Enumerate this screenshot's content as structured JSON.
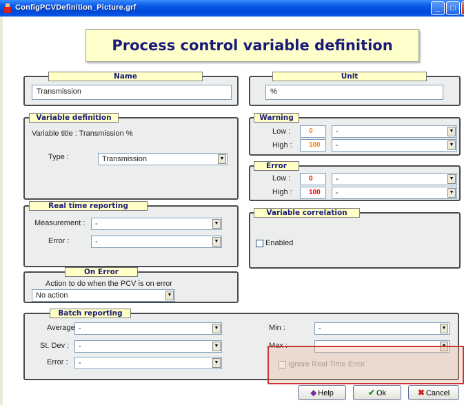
{
  "window": {
    "title": "ConfigPCVDefinition_Picture.grf"
  },
  "header": {
    "title": "Process control variable definition"
  },
  "name_group": {
    "label": "Name",
    "value": "Transmission"
  },
  "unit_group": {
    "label": "Unit",
    "value": "%"
  },
  "variable_definition": {
    "label": "Variable definition",
    "title_text": "Variable title : Transmission  %",
    "type_label": "Type :",
    "type_value": "Transmission"
  },
  "warning": {
    "label": "Warning",
    "low_label": "Low :",
    "low_value": "0",
    "low_select": "-",
    "high_label": "High :",
    "high_value": "100",
    "high_select": "-"
  },
  "error": {
    "label": "Error",
    "low_label": "Low :",
    "low_value": "0",
    "low_select": "-",
    "high_label": "High :",
    "high_value": "100",
    "high_select": "-"
  },
  "real_time": {
    "label": "Real time reporting",
    "measurement_label": "Measurement :",
    "measurement_value": "-",
    "error_label": "Error :",
    "error_value": "-"
  },
  "variable_correlation": {
    "label": "Variable correlation",
    "enabled_label": "Enabled"
  },
  "on_error": {
    "label": "On Error",
    "description": "Action to do when the PCV is on error",
    "action_value": "No action"
  },
  "batch": {
    "label": "Batch reporting",
    "average_label": "Average :",
    "average_value": "-",
    "stdev_label": "St. Dev :",
    "stdev_value": "-",
    "error_label": "Error :",
    "error_value": "-",
    "min_label": "Min :",
    "min_value": "-",
    "max_label": "Max :",
    "max_value": "-",
    "ignore_label": "Ignore Real Time Error"
  },
  "buttons": {
    "help": "Help",
    "ok": "Ok",
    "cancel": "Cancel"
  },
  "colors": {
    "warning_value": "#FF8000",
    "error_value": "#FF0000",
    "label_text": "#1A1A7A",
    "highlight_border": "#CC3333"
  }
}
